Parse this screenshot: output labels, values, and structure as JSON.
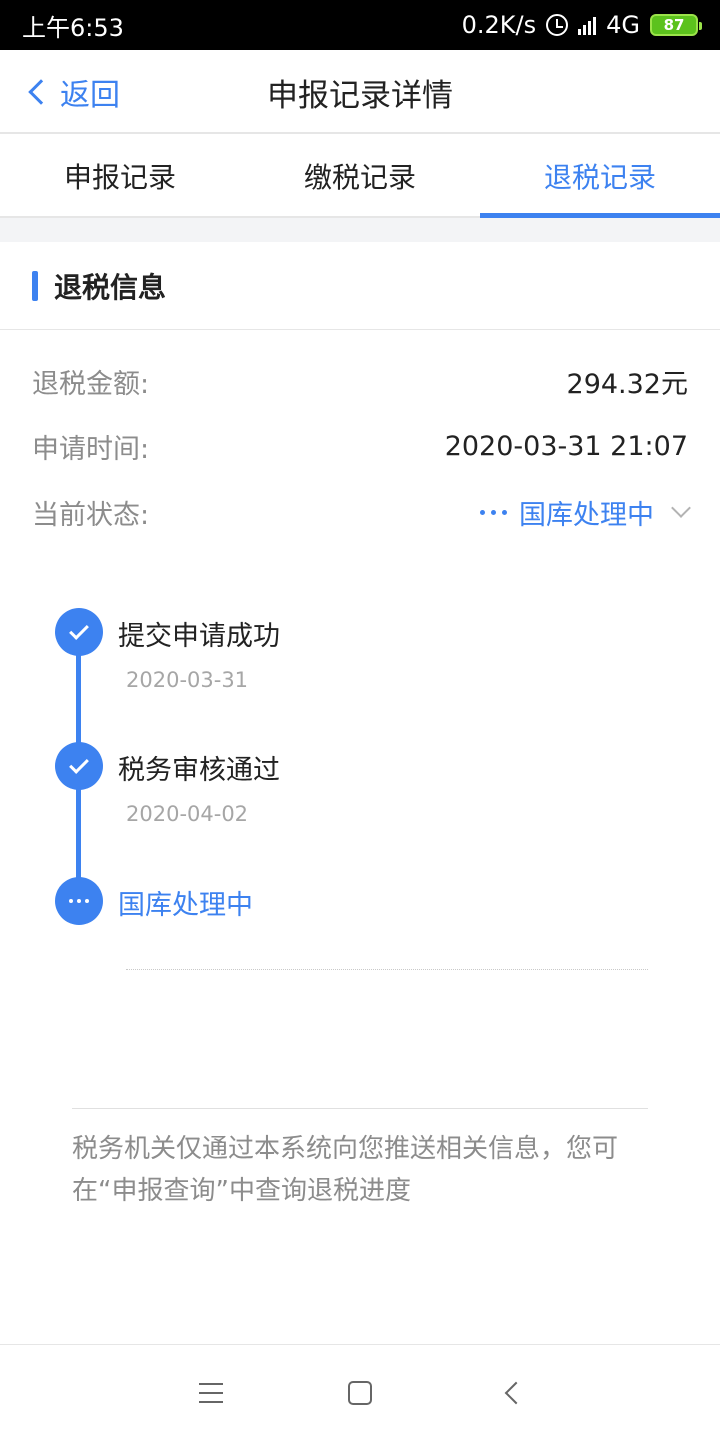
{
  "status_bar": {
    "time": "上午6:53",
    "speed": "0.2K/s",
    "network": "4G",
    "battery": "87"
  },
  "nav": {
    "back_label": "返回",
    "title": "申报记录详情"
  },
  "tabs": [
    {
      "label": "申报记录"
    },
    {
      "label": "缴税记录"
    },
    {
      "label": "退税记录",
      "active": true
    }
  ],
  "section": {
    "title": "退税信息"
  },
  "info": {
    "amount_label": "退税金额:",
    "amount_value": "294.32元",
    "time_label": "申请时间:",
    "time_value": "2020-03-31 21:07",
    "status_label": "当前状态:",
    "status_value": "国库处理中"
  },
  "timeline": [
    {
      "title": "提交申请成功",
      "date": "2020-03-31",
      "done": true
    },
    {
      "title": "税务审核通过",
      "date": "2020-04-02",
      "done": true
    },
    {
      "title": "国库处理中",
      "current": true
    }
  ],
  "notice": "税务机关仅通过本系统向您推送相关信息，您可在“申报查询”中查询退税进度",
  "colors": {
    "accent": "#3d82f0",
    "label_gray": "#8c8c8c",
    "battery_green": "#5cc21d"
  }
}
